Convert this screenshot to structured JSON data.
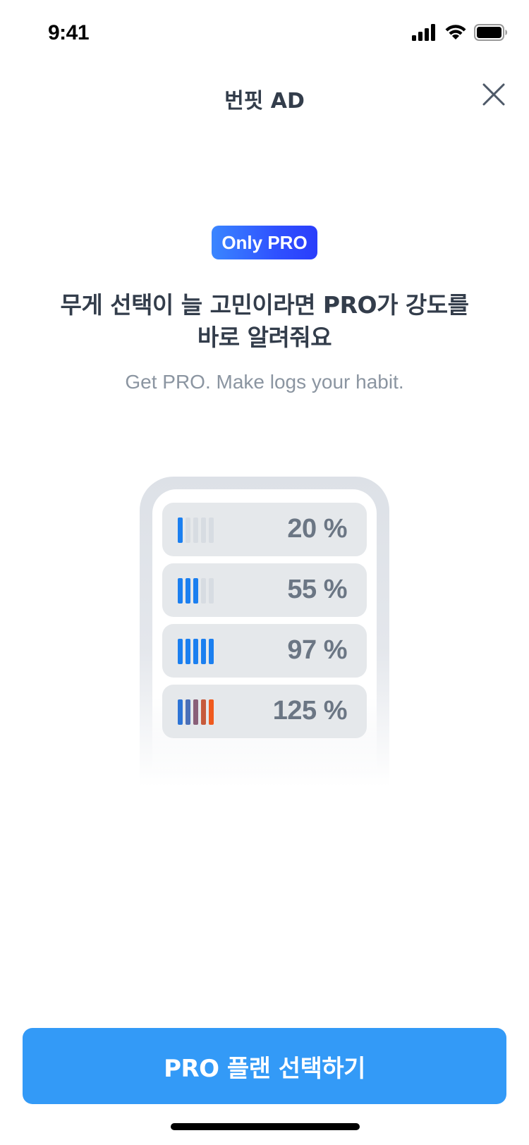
{
  "status_bar": {
    "time": "9:41",
    "icons": [
      "cellular-signal-icon",
      "wifi-icon",
      "battery-icon"
    ]
  },
  "header": {
    "title": "번핏 AD",
    "close_icon": "close-icon"
  },
  "badge": {
    "label": "Only PRO",
    "colors": [
      "#3a86ff",
      "#2a3dfb"
    ]
  },
  "headline": {
    "line1": "무게 선택이 늘 고민이라면 PRO가 강도를",
    "line2": "바로 알려줘요"
  },
  "subtitle": "Get PRO. Make logs your habit.",
  "intensity_levels": [
    {
      "percent_label": "20 %",
      "filled_bars": 1,
      "bar_colors": [
        "#1b7ff0",
        "#d7dce2",
        "#d7dce2",
        "#d7dce2",
        "#d7dce2"
      ]
    },
    {
      "percent_label": "55 %",
      "filled_bars": 3,
      "bar_colors": [
        "#1b7ff0",
        "#1b7ff0",
        "#1b7ff0",
        "#d7dce2",
        "#d7dce2"
      ]
    },
    {
      "percent_label": "97 %",
      "filled_bars": 5,
      "bar_colors": [
        "#1b7ff0",
        "#1b7ff0",
        "#1b7ff0",
        "#1b7ff0",
        "#1b7ff0"
      ]
    },
    {
      "percent_label": "125 %",
      "filled_bars": 5,
      "bar_colors": [
        "#2d74d6",
        "#4a6fb8",
        "#8a5f78",
        "#c65a3b",
        "#f05a1e"
      ]
    }
  ],
  "cta": {
    "label": "PRO 플랜 선택하기",
    "color": "#339af7"
  }
}
